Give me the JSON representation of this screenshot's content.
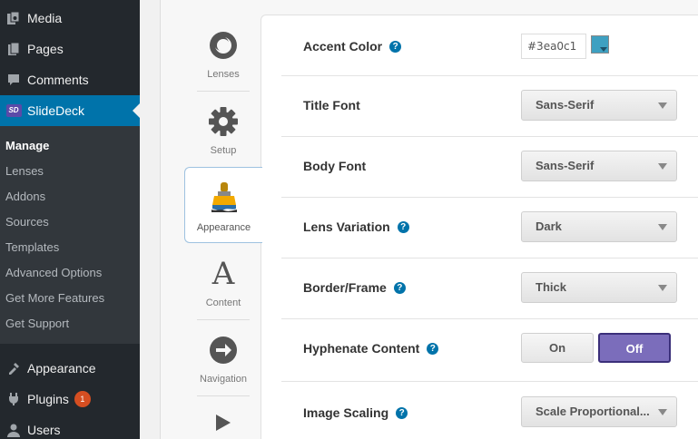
{
  "sidebar": {
    "menu_top": [
      {
        "label": "Media",
        "icon": "media-icon"
      },
      {
        "label": "Pages",
        "icon": "pages-icon"
      },
      {
        "label": "Comments",
        "icon": "comments-icon"
      },
      {
        "label": "SlideDeck",
        "icon": "slidedeck-icon"
      }
    ],
    "submenu": [
      "Manage",
      "Lenses",
      "Addons",
      "Sources",
      "Templates",
      "Advanced Options",
      "Get More Features",
      "Get Support"
    ],
    "menu_bottom": [
      {
        "label": "Appearance",
        "icon": "appearance-icon"
      },
      {
        "label": "Plugins",
        "icon": "plugins-icon",
        "badge": "1"
      },
      {
        "label": "Users",
        "icon": "users-icon"
      }
    ],
    "slidedeck_icon_text": "SD"
  },
  "tabs": [
    {
      "label": "Lenses",
      "icon": "lenses-icon"
    },
    {
      "label": "Setup",
      "icon": "gear-icon"
    },
    {
      "label": "Appearance",
      "icon": "paintbrush-icon"
    },
    {
      "label": "Content",
      "icon": "font-a-icon",
      "glyph": "A"
    },
    {
      "label": "Navigation",
      "icon": "arrow-right-circle-icon"
    },
    {
      "label": "",
      "icon": "play-icon"
    }
  ],
  "options": {
    "accent_color": {
      "label": "Accent Color",
      "value": "#3ea0c1"
    },
    "title_font": {
      "label": "Title Font",
      "value": "Sans-Serif"
    },
    "body_font": {
      "label": "Body Font",
      "value": "Sans-Serif"
    },
    "lens_variation": {
      "label": "Lens Variation",
      "value": "Dark"
    },
    "border_frame": {
      "label": "Border/Frame",
      "value": "Thick"
    },
    "hyphenate": {
      "label": "Hyphenate Content",
      "on_label": "On",
      "off_label": "Off",
      "selected": "Off"
    },
    "image_scaling": {
      "label": "Image Scaling",
      "value": "Scale Proportional..."
    }
  },
  "help_glyph": "?",
  "colors": {
    "accent": "#3ea0c1",
    "wp_active": "#0073aa",
    "toggle_off": "#7b6dbb"
  }
}
